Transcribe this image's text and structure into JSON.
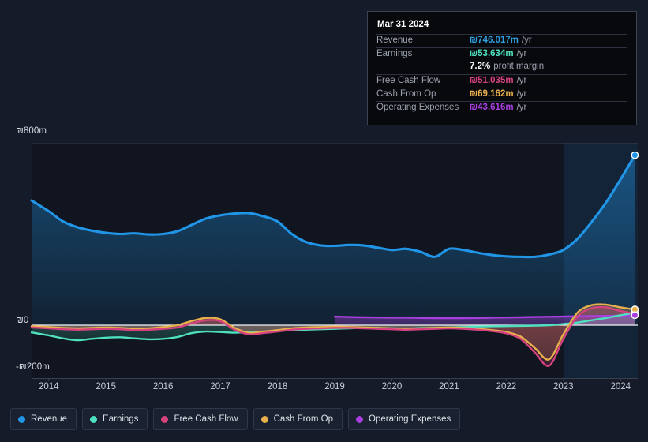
{
  "tooltip": {
    "date": "Mar 31 2024",
    "rows": [
      {
        "label": "Revenue",
        "value": "₪746.017m",
        "unit": "/yr",
        "color": "#2F9FE0"
      },
      {
        "label": "Earnings",
        "value": "₪53.634m",
        "unit": "/yr",
        "color": "#4FE0C0"
      },
      {
        "label": "",
        "value": "7.2%",
        "unit": "profit margin",
        "color": "#FFFFFF"
      },
      {
        "label": "Free Cash Flow",
        "value": "₪51.035m",
        "unit": "/yr",
        "color": "#D6437F"
      },
      {
        "label": "Cash From Op",
        "value": "₪69.162m",
        "unit": "/yr",
        "color": "#E8B04D"
      },
      {
        "label": "Operating Expenses",
        "value": "₪43.616m",
        "unit": "/yr",
        "color": "#A93FE0"
      }
    ]
  },
  "axis": {
    "y_labels": [
      {
        "text": "₪800m",
        "value": 800
      },
      {
        "text": "₪0",
        "value": 0
      },
      {
        "text": "-₪200m",
        "value": -200
      }
    ],
    "x_labels": [
      "2014",
      "2015",
      "2016",
      "2017",
      "2018",
      "2019",
      "2020",
      "2021",
      "2022",
      "2023",
      "2024"
    ]
  },
  "legend": [
    {
      "label": "Revenue",
      "color": "#2196E8"
    },
    {
      "label": "Earnings",
      "color": "#4FE0C0"
    },
    {
      "label": "Free Cash Flow",
      "color": "#D6437F"
    },
    {
      "label": "Cash From Op",
      "color": "#E8B04D"
    },
    {
      "label": "Operating Expenses",
      "color": "#A93FE0"
    }
  ],
  "chart_data": {
    "type": "line",
    "title": "",
    "xlabel": "",
    "ylabel": "",
    "ylim": [
      -200,
      800
    ],
    "xlim": [
      "2013.6",
      "2024.3"
    ],
    "grid": true,
    "currency": "₪",
    "units": "millions per year",
    "legend_position": "bottom-left",
    "highlight_band": {
      "from": "2023.0",
      "to": "2024.3",
      "meaning": "forecast-period shading"
    },
    "endpoint_markers": {
      "x": "2024.25",
      "series": [
        "Revenue",
        "Earnings",
        "Free Cash Flow",
        "Cash From Op",
        "Operating Expenses"
      ]
    },
    "x": [
      2013.7,
      2014.0,
      2014.25,
      2014.5,
      2014.75,
      2015.0,
      2015.25,
      2015.5,
      2015.75,
      2016.0,
      2016.25,
      2016.5,
      2016.75,
      2017.0,
      2017.25,
      2017.5,
      2017.75,
      2018.0,
      2018.25,
      2018.5,
      2018.75,
      2019.0,
      2019.25,
      2019.5,
      2019.75,
      2020.0,
      2020.25,
      2020.5,
      2020.75,
      2021.0,
      2021.25,
      2021.5,
      2021.75,
      2022.0,
      2022.25,
      2022.5,
      2022.75,
      2023.0,
      2023.25,
      2023.5,
      2023.75,
      2024.0,
      2024.25
    ],
    "series": [
      {
        "name": "Revenue",
        "color": "#2196E8",
        "values": [
          547,
          500,
          455,
          430,
          415,
          405,
          400,
          403,
          398,
          400,
          412,
          440,
          468,
          482,
          490,
          492,
          478,
          455,
          400,
          365,
          350,
          348,
          352,
          350,
          340,
          330,
          335,
          322,
          300,
          335,
          330,
          318,
          308,
          302,
          300,
          300,
          310,
          330,
          380,
          455,
          540,
          640,
          746
        ]
      },
      {
        "name": "Earnings",
        "color": "#4FE0C0",
        "values": [
          -32,
          -45,
          -58,
          -66,
          -60,
          -55,
          -53,
          -58,
          -62,
          -60,
          -52,
          -35,
          -28,
          -30,
          -33,
          -30,
          -28,
          -26,
          -22,
          -20,
          -18,
          -16,
          -14,
          -12,
          -12,
          -14,
          -15,
          -13,
          -12,
          -10,
          -8,
          -6,
          -5,
          -4,
          -3,
          -2,
          0,
          5,
          12,
          22,
          32,
          44,
          54
        ]
      },
      {
        "name": "Free Cash Flow",
        "color": "#D6437F",
        "values": [
          -10,
          -14,
          -18,
          -20,
          -18,
          -16,
          -18,
          -22,
          -20,
          -16,
          -10,
          8,
          22,
          18,
          -20,
          -40,
          -35,
          -28,
          -20,
          -16,
          -14,
          -12,
          -12,
          -14,
          -16,
          -18,
          -20,
          -18,
          -16,
          -14,
          -16,
          -20,
          -26,
          -36,
          -60,
          -120,
          -178,
          -60,
          40,
          75,
          78,
          62,
          51
        ]
      },
      {
        "name": "Cash From Op",
        "color": "#E8B04D",
        "values": [
          -4,
          -8,
          -12,
          -14,
          -12,
          -10,
          -12,
          -16,
          -14,
          -8,
          0,
          18,
          32,
          26,
          -12,
          -34,
          -28,
          -22,
          -14,
          -10,
          -8,
          -6,
          -8,
          -10,
          -12,
          -14,
          -16,
          -14,
          -12,
          -10,
          -12,
          -16,
          -22,
          -30,
          -50,
          -100,
          -150,
          -40,
          56,
          88,
          90,
          78,
          69
        ]
      },
      {
        "name": "Operating Expenses",
        "color": "#A93FE0",
        "values": [
          null,
          null,
          null,
          null,
          null,
          null,
          null,
          null,
          null,
          null,
          null,
          null,
          null,
          null,
          null,
          null,
          null,
          null,
          null,
          null,
          null,
          38,
          36,
          35,
          34,
          33,
          33,
          32,
          31,
          31,
          31,
          32,
          33,
          34,
          35,
          36,
          37,
          38,
          39,
          40,
          41,
          42,
          44
        ]
      }
    ]
  }
}
